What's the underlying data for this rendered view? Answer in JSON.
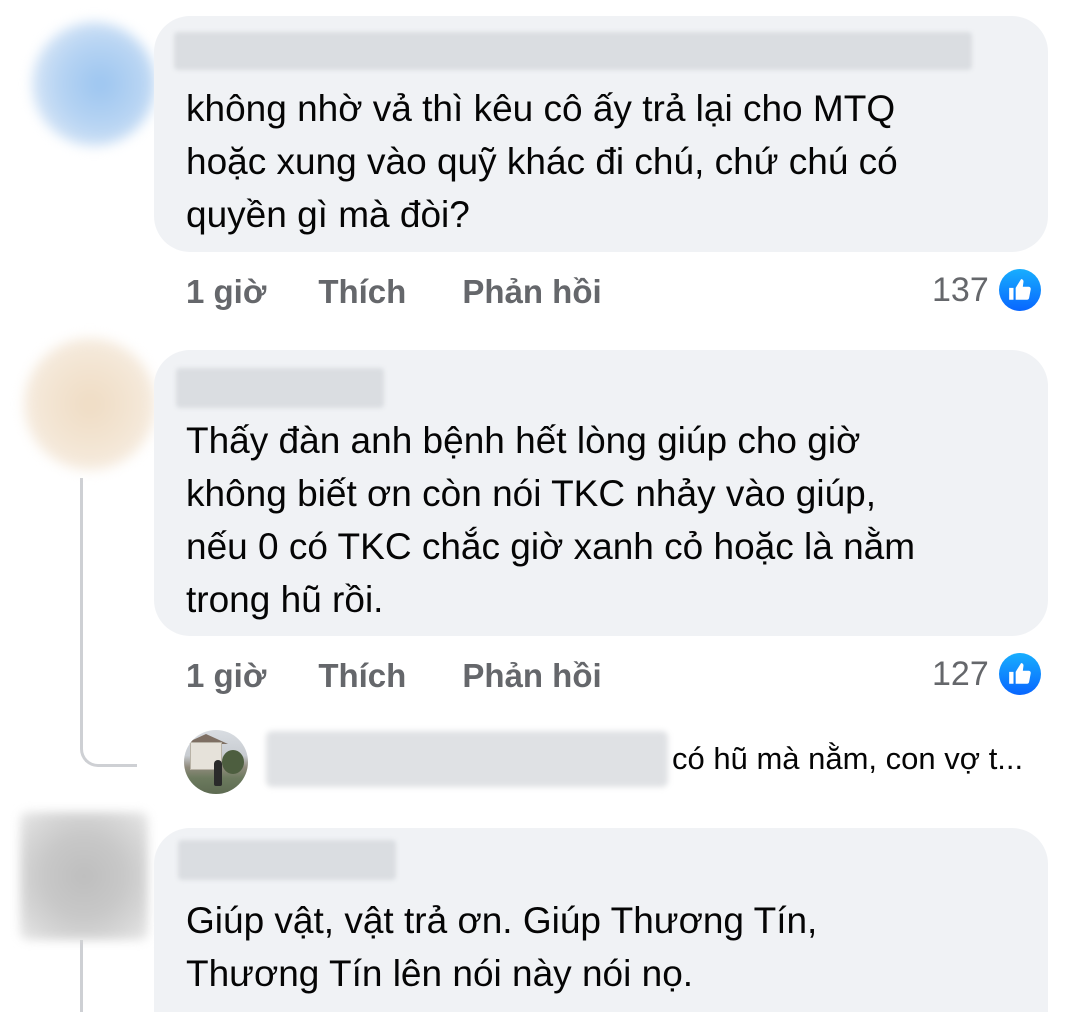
{
  "comments": [
    {
      "text": "không nhờ vả thì kêu cô ấy trả lại cho MTQ\nhoặc xung vào quỹ khác đi chú, chứ chú có\nquyền gì mà đòi?",
      "time": "1 giờ",
      "like_label": "Thích",
      "reply_label": "Phản hồi",
      "reaction_count": "137"
    },
    {
      "text": "Thấy đàn anh bệnh hết lòng giúp cho giờ\nkhông biết ơn còn nói TKC nhảy vào giúp,\nnếu 0 có TKC chắc giờ xanh cỏ hoặc là nằm\ntrong hũ rồi.",
      "time": "1 giờ",
      "like_label": "Thích",
      "reply_label": "Phản hồi",
      "reaction_count": "127",
      "reply_preview": {
        "snippet": "có hũ mà nằm, con vợ t..."
      }
    },
    {
      "text": "Giúp vật, vật trả ơn. Giúp Thương Tín,\nThương Tín lên nói này nói nọ."
    }
  ],
  "colors": {
    "bubble": "#f0f2f5",
    "meta_text": "#65676b",
    "like_blue": "#0866ff"
  },
  "icons": {
    "reaction": "like-thumbs-up-icon"
  }
}
